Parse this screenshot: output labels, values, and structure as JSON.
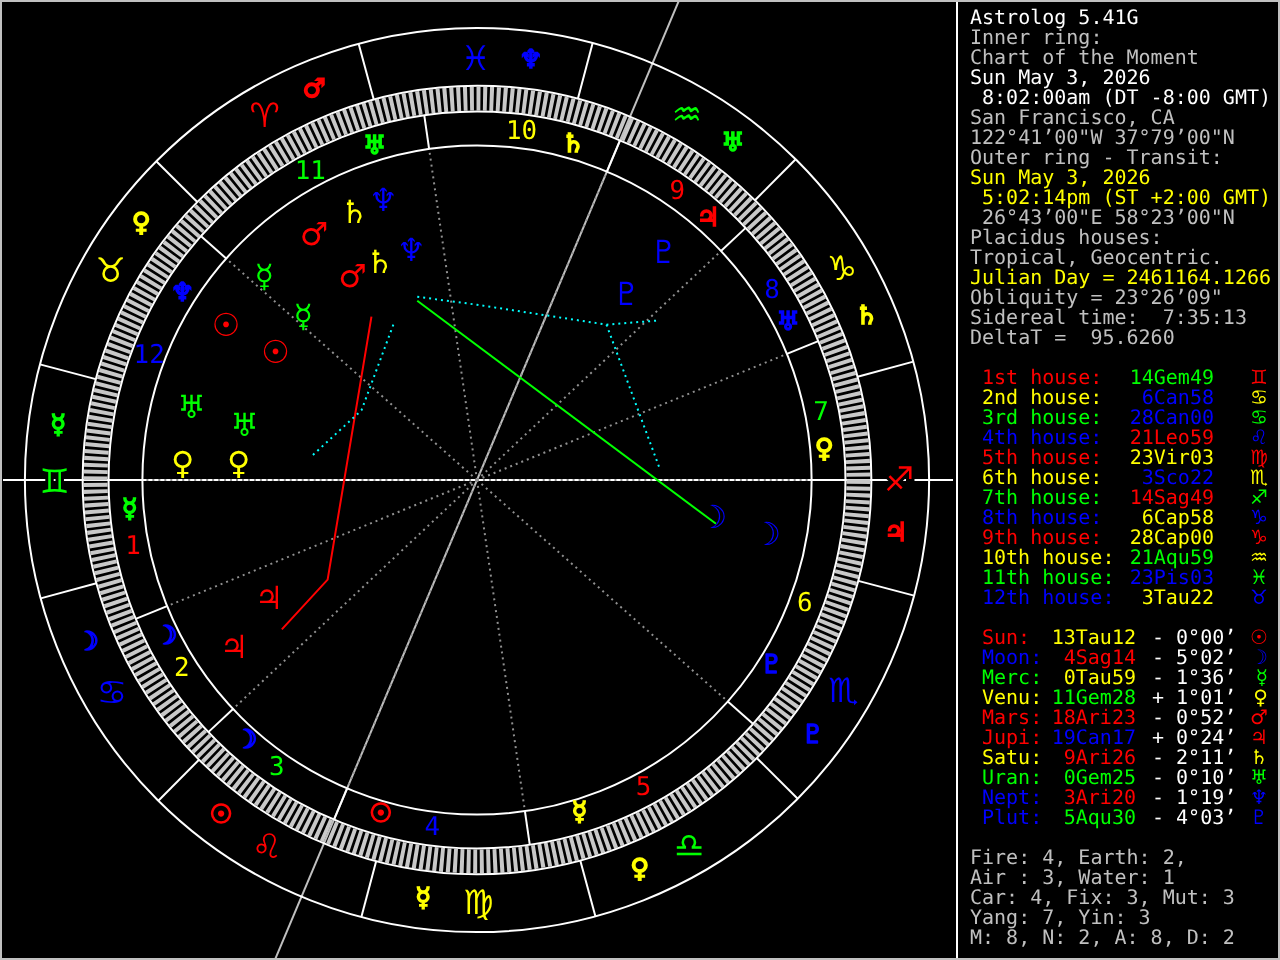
{
  "info_lines": [
    {
      "text": "Astrolog 5.41G",
      "color": "#ffffff"
    },
    {
      "text": "Inner ring:",
      "color": "#c0c0c0"
    },
    {
      "text": "Chart of the Moment",
      "color": "#c0c0c0"
    },
    {
      "text": "Sun May 3, 2026",
      "color": "#ffffff"
    },
    {
      "text": " 8:02:00am (DT -8:00 GMT)",
      "color": "#ffffff"
    },
    {
      "text": "San Francisco, CA",
      "color": "#c0c0c0"
    },
    {
      "text": "122°41’00\"W 37°79’00\"N",
      "color": "#c0c0c0"
    },
    {
      "text": "Outer ring - Transit:",
      "color": "#c0c0c0"
    },
    {
      "text": "Sun May 3, 2026",
      "color": "#ffff00"
    },
    {
      "text": " 5:02:14pm (ST +2:00 GMT)",
      "color": "#ffff00"
    },
    {
      "text": " 26°43’00\"E 58°23’00\"N",
      "color": "#c0c0c0"
    },
    {
      "text": "Placidus houses:",
      "color": "#c0c0c0"
    },
    {
      "text": "Tropical, Geocentric.",
      "color": "#c0c0c0"
    },
    {
      "text": "Julian Day = 2461164.1266",
      "color": "#ffff00"
    },
    {
      "text": "Obliquity = 23°26’09\"",
      "color": "#c0c0c0"
    },
    {
      "text": "Sidereal time:  7:35:13",
      "color": "#c0c0c0"
    },
    {
      "text": "DeltaT =  95.6260",
      "color": "#c0c0c0"
    }
  ],
  "houses": [
    {
      "label": "1st house:",
      "color": "#ff0000",
      "cusp": {
        "text": "14Gem49",
        "color": "#00ff00"
      },
      "glyph": "♊"
    },
    {
      "label": "2nd house:",
      "color": "#ffff00",
      "cusp": {
        "text": "6Can58",
        "color": "#0000ff"
      },
      "glyph": "♋"
    },
    {
      "label": "3rd house:",
      "color": "#00ff00",
      "cusp": {
        "text": "28Can00",
        "color": "#0000ff"
      },
      "glyph": "♋"
    },
    {
      "label": "4th house:",
      "color": "#0000ff",
      "cusp": {
        "text": "21Leo59",
        "color": "#ff0000"
      },
      "glyph": "♌"
    },
    {
      "label": "5th house:",
      "color": "#ff0000",
      "cusp": {
        "text": "23Vir03",
        "color": "#ffff00"
      },
      "glyph": "♍"
    },
    {
      "label": "6th house:",
      "color": "#ffff00",
      "cusp": {
        "text": "3Sco22",
        "color": "#0000ff"
      },
      "glyph": "♏"
    },
    {
      "label": "7th house:",
      "color": "#00ff00",
      "cusp": {
        "text": "14Sag49",
        "color": "#ff0000"
      },
      "glyph": "♐"
    },
    {
      "label": "8th house:",
      "color": "#0000ff",
      "cusp": {
        "text": "6Cap58",
        "color": "#ffff00"
      },
      "glyph": "♑"
    },
    {
      "label": "9th house:",
      "color": "#ff0000",
      "cusp": {
        "text": "28Cap00",
        "color": "#ffff00"
      },
      "glyph": "♑"
    },
    {
      "label": "10th house:",
      "color": "#ffff00",
      "cusp": {
        "text": "21Aqu59",
        "color": "#00ff00"
      },
      "glyph": "♒"
    },
    {
      "label": "11th house:",
      "color": "#00ff00",
      "cusp": {
        "text": "23Pis03",
        "color": "#0000ff"
      },
      "glyph": "♓"
    },
    {
      "label": "12th house:",
      "color": "#0000ff",
      "cusp": {
        "text": "3Tau22",
        "color": "#ffff00"
      },
      "glyph": "♉"
    }
  ],
  "planets": [
    {
      "name": "Sun:",
      "color": "#ff0000",
      "position": {
        "text": "13Tau12",
        "color": "#ffff00"
      },
      "latitude": "- 0°00’",
      "glyph": "☉"
    },
    {
      "name": "Moon:",
      "color": "#0000ff",
      "position": {
        "text": "4Sag14",
        "color": "#ff0000"
      },
      "latitude": "- 5°02’",
      "glyph": "☽"
    },
    {
      "name": "Merc:",
      "color": "#00ff00",
      "position": {
        "text": "0Tau59",
        "color": "#ffff00"
      },
      "latitude": "- 1°36’",
      "glyph": "☿"
    },
    {
      "name": "Venu:",
      "color": "#ffff00",
      "position": {
        "text": "11Gem28",
        "color": "#00ff00"
      },
      "latitude": "+ 1°01’",
      "glyph": "♀"
    },
    {
      "name": "Mars:",
      "color": "#ff0000",
      "position": {
        "text": "18Ari23",
        "color": "#ff0000"
      },
      "latitude": "- 0°52’",
      "glyph": "♂"
    },
    {
      "name": "Jupi:",
      "color": "#ff0000",
      "position": {
        "text": "19Can17",
        "color": "#0000ff"
      },
      "latitude": "+ 0°24’",
      "glyph": "♃"
    },
    {
      "name": "Satu:",
      "color": "#ffff00",
      "position": {
        "text": "9Ari26",
        "color": "#ff0000"
      },
      "latitude": "- 2°11’",
      "glyph": "♄"
    },
    {
      "name": "Uran:",
      "color": "#00ff00",
      "position": {
        "text": "0Gem25",
        "color": "#00ff00"
      },
      "latitude": "- 0°10’",
      "glyph": "♅"
    },
    {
      "name": "Nept:",
      "color": "#0000ff",
      "position": {
        "text": "3Ari20",
        "color": "#ff0000"
      },
      "latitude": "- 1°19’",
      "glyph": "♆"
    },
    {
      "name": "Plut:",
      "color": "#0000ff",
      "position": {
        "text": "5Aqu30",
        "color": "#00ff00"
      },
      "latitude": "- 4°03’",
      "glyph": "♇"
    }
  ],
  "summary_lines": [
    "Fire: 4, Earth: 2,",
    "Air : 3, Water: 1",
    "Car: 4, Fix: 3, Mut: 3",
    "Yang: 7, Yin: 3",
    "M: 8, N: 2, A: 8, D: 2"
  ],
  "wheel": {
    "signs": [
      {
        "glyph": "♈",
        "color": "#ff0000",
        "ruler": {
          "glyph": "♂",
          "color": "#ff0000"
        }
      },
      {
        "glyph": "♉",
        "color": "#ffff00",
        "ruler": {
          "glyph": "♀",
          "color": "#ffff00"
        }
      },
      {
        "glyph": "♊",
        "color": "#00ff00",
        "ruler": {
          "glyph": "☿",
          "color": "#00ff00"
        }
      },
      {
        "glyph": "♋",
        "color": "#0000ff",
        "ruler": {
          "glyph": "☽",
          "color": "#0000ff"
        }
      },
      {
        "glyph": "♌",
        "color": "#ff0000",
        "ruler": {
          "glyph": "☉",
          "color": "#ff0000"
        }
      },
      {
        "glyph": "♍",
        "color": "#ffff00",
        "ruler": {
          "glyph": "☿",
          "color": "#ffff00"
        }
      },
      {
        "glyph": "♎",
        "color": "#00ff00",
        "ruler": {
          "glyph": "♀",
          "color": "#ffff00"
        }
      },
      {
        "glyph": "♏",
        "color": "#0000ff",
        "ruler": {
          "glyph": "♇",
          "color": "#0000ff"
        }
      },
      {
        "glyph": "♐",
        "color": "#ff0000",
        "ruler": {
          "glyph": "♃",
          "color": "#ff0000"
        }
      },
      {
        "glyph": "♑",
        "color": "#ffff00",
        "ruler": {
          "glyph": "♄",
          "color": "#ffff00"
        }
      },
      {
        "glyph": "♒",
        "color": "#00ff00",
        "ruler": {
          "glyph": "♅",
          "color": "#00ff00"
        }
      },
      {
        "glyph": "♓",
        "color": "#0000ff",
        "ruler": {
          "glyph": "♆",
          "color": "#0000ff"
        }
      }
    ],
    "house_numbers": [
      {
        "text": "1",
        "color": "#ff0000",
        "ruler": {
          "glyph": "☿",
          "color": "#00ff00"
        }
      },
      {
        "text": "2",
        "color": "#ffff00",
        "ruler": {
          "glyph": "☽",
          "color": "#0000ff"
        }
      },
      {
        "text": "3",
        "color": "#00ff00",
        "ruler": {
          "glyph": "☽",
          "color": "#0000ff"
        }
      },
      {
        "text": "4",
        "color": "#0000ff",
        "ruler": {
          "glyph": "☉",
          "color": "#ff0000"
        }
      },
      {
        "text": "5",
        "color": "#ff0000",
        "ruler": {
          "glyph": "☿",
          "color": "#ffff00"
        }
      },
      {
        "text": "6",
        "color": "#ffff00",
        "ruler": {
          "glyph": "♇",
          "color": "#0000ff"
        }
      },
      {
        "text": "7",
        "color": "#00ff00",
        "ruler": {
          "glyph": "♀",
          "color": "#ffff00"
        }
      },
      {
        "text": "8",
        "color": "#0000ff",
        "ruler": {
          "glyph": "♅",
          "color": "#0000ff"
        }
      },
      {
        "text": "9",
        "color": "#ff0000",
        "ruler": {
          "glyph": "♃",
          "color": "#ff0000"
        }
      },
      {
        "text": "10",
        "color": "#ffff00",
        "ruler": {
          "glyph": "♄",
          "color": "#ffff00"
        }
      },
      {
        "text": "11",
        "color": "#00ff00",
        "ruler": {
          "glyph": "♅",
          "color": "#00ff00"
        }
      },
      {
        "text": "12",
        "color": "#0000ff",
        "ruler": {
          "glyph": "♆",
          "color": "#0000ff"
        }
      }
    ],
    "natal_planets": [
      {
        "glyph": "☉",
        "color": "#ff0000"
      },
      {
        "glyph": "☽",
        "color": "#0000ff"
      },
      {
        "glyph": "☿",
        "color": "#00ff00"
      },
      {
        "glyph": "♀",
        "color": "#ffff00"
      },
      {
        "glyph": "♂",
        "color": "#ff0000"
      },
      {
        "glyph": "♃",
        "color": "#ff0000"
      },
      {
        "glyph": "♄",
        "color": "#ffff00"
      },
      {
        "glyph": "♅",
        "color": "#00ff00"
      },
      {
        "glyph": "♆",
        "color": "#0000ff"
      },
      {
        "glyph": "♇",
        "color": "#0000ff"
      }
    ],
    "transit_planets": [
      {
        "glyph": "☉",
        "color": "#ff0000"
      },
      {
        "glyph": "☽",
        "color": "#0000ff"
      },
      {
        "glyph": "☿",
        "color": "#00ff00"
      },
      {
        "glyph": "♀",
        "color": "#ffff00"
      },
      {
        "glyph": "♂",
        "color": "#ff0000"
      },
      {
        "glyph": "♃",
        "color": "#ff0000"
      },
      {
        "glyph": "♄",
        "color": "#ffff00"
      },
      {
        "glyph": "♅",
        "color": "#00ff00"
      },
      {
        "glyph": "♆",
        "color": "#0000ff"
      },
      {
        "glyph": "♇",
        "color": "#0000ff"
      }
    ]
  }
}
